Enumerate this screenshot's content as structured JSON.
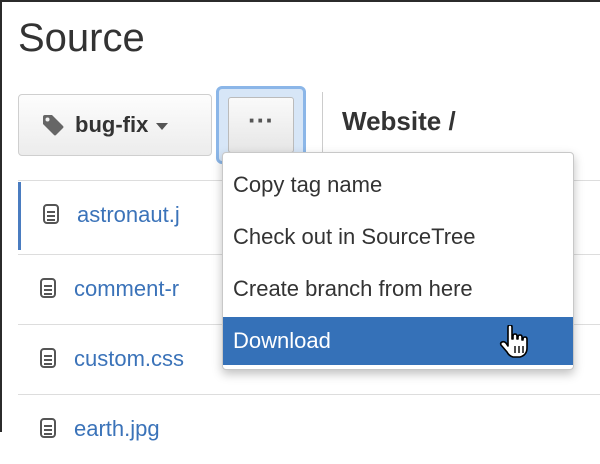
{
  "page": {
    "title": "Source"
  },
  "toolbar": {
    "branch_label": "bug-fix",
    "more_label": "···",
    "breadcrumb": "Website /"
  },
  "files": [
    {
      "name": "astronaut.j"
    },
    {
      "name": "comment-r"
    },
    {
      "name": "custom.css"
    },
    {
      "name": "earth.jpg"
    }
  ],
  "menu": {
    "items": [
      {
        "label": "Copy tag name"
      },
      {
        "label": "Check out in SourceTree"
      },
      {
        "label": "Create branch from here"
      },
      {
        "label": "Download"
      }
    ],
    "selected_index": 3
  },
  "icons": {
    "branch": "tag-icon",
    "file": "file-icon",
    "cursor": "hand-cursor-icon",
    "dropdown": "caret-down-icon"
  },
  "colors": {
    "link": "#3b73b9",
    "selected_bg": "#3571b8",
    "focus_ring": "#8bb6e8"
  }
}
